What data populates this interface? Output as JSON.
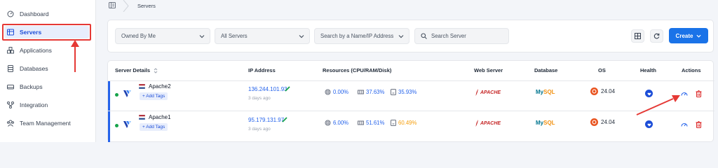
{
  "sidebar": {
    "items": [
      {
        "label": "Dashboard",
        "icon": "dashboard-icon"
      },
      {
        "label": "Servers",
        "icon": "servers-icon",
        "active": true
      },
      {
        "label": "Applications",
        "icon": "applications-icon"
      },
      {
        "label": "Databases",
        "icon": "databases-icon"
      },
      {
        "label": "Backups",
        "icon": "backups-icon"
      },
      {
        "label": "Integration",
        "icon": "integration-icon"
      },
      {
        "label": "Team Management",
        "icon": "team-icon"
      }
    ]
  },
  "breadcrumb": {
    "current": "Servers"
  },
  "filters": {
    "owned_by": "Owned By Me",
    "servers": "All Servers",
    "search_by_placeholder": "Search by a Name/IP Address",
    "search_placeholder": "Search Server"
  },
  "toolbar": {
    "create_label": "Create"
  },
  "table": {
    "columns": [
      "Server Details",
      "IP Address",
      "Resources (CPU/RAM/Disk)",
      "Web Server",
      "Database",
      "OS",
      "Health",
      "Actions"
    ],
    "rows": [
      {
        "name": "Apache2",
        "add_tags": "+ Add Tags",
        "ip": "136.244.101.93",
        "ago": "3 days ago",
        "cpu": "0.00%",
        "ram": "37.63%",
        "disk": "35.93%",
        "web_server": "APACHE",
        "db_my": "My",
        "db_sql": "SQL",
        "os": "24.04"
      },
      {
        "name": "Apache1",
        "add_tags": "+ Add Tags",
        "ip": "95.179.131.97",
        "ago": "3 days ago",
        "cpu": "6.00%",
        "ram": "51.61%",
        "disk": "60.49%",
        "web_server": "APACHE",
        "db_my": "My",
        "db_sql": "SQL",
        "os": "24.04"
      }
    ]
  },
  "colors": {
    "accent": "#1a73e8",
    "annotation": "#e53935",
    "status_online": "#16a34a",
    "disk_warning": "#f59e0b"
  }
}
